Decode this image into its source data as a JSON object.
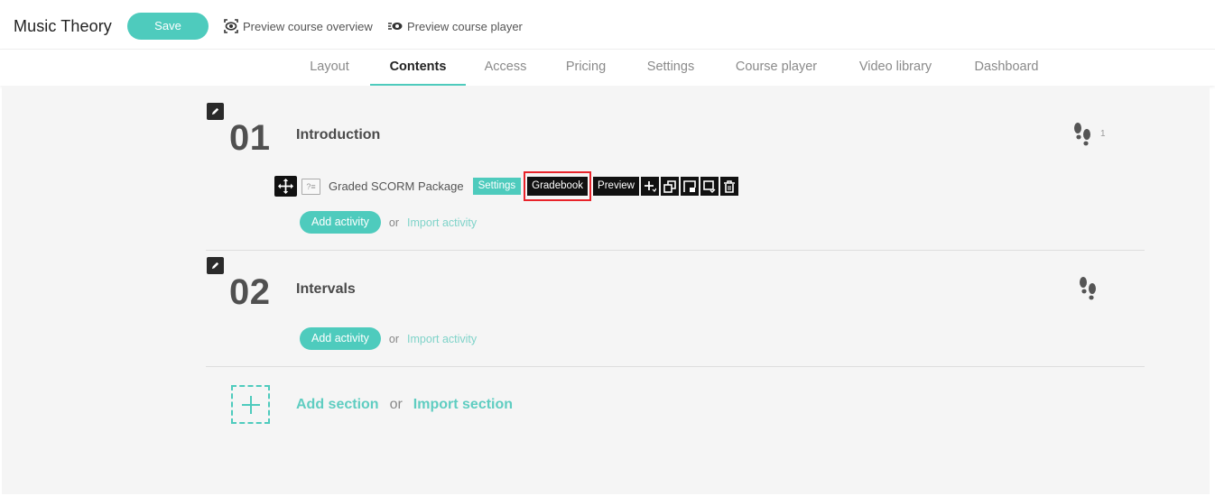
{
  "header": {
    "title": "Music Theory",
    "save_label": "Save",
    "preview_overview_label": "Preview course overview",
    "preview_player_label": "Preview course player"
  },
  "tabs": [
    {
      "label": "Layout",
      "active": false
    },
    {
      "label": "Contents",
      "active": true
    },
    {
      "label": "Access",
      "active": false
    },
    {
      "label": "Pricing",
      "active": false
    },
    {
      "label": "Settings",
      "active": false
    },
    {
      "label": "Course player",
      "active": false
    },
    {
      "label": "Video library",
      "active": false
    },
    {
      "label": "Dashboard",
      "active": false
    }
  ],
  "sections": [
    {
      "number": "01",
      "title": "Introduction",
      "steps_count": "1",
      "activities": [
        {
          "name": "Graded SCORM Package",
          "type_icon": "scorm-icon",
          "type_icon_text": "?≡",
          "buttons": {
            "settings": "Settings",
            "gradebook": "Gradebook",
            "preview": "Preview"
          },
          "highlighted_button": "Gradebook"
        }
      ],
      "add_activity_label": "Add activity",
      "or_label": "or",
      "import_activity_label": "Import activity"
    },
    {
      "number": "02",
      "title": "Intervals",
      "steps_count": "",
      "activities": [],
      "add_activity_label": "Add activity",
      "or_label": "or",
      "import_activity_label": "Import activity"
    }
  ],
  "add_section": {
    "add_label": "Add section",
    "or_label": "or",
    "import_label": "Import section"
  },
  "colors": {
    "accent": "#4ecbbd",
    "highlight_border": "#e8232a",
    "dark_button": "#111111",
    "background": "#f5f5f5"
  }
}
